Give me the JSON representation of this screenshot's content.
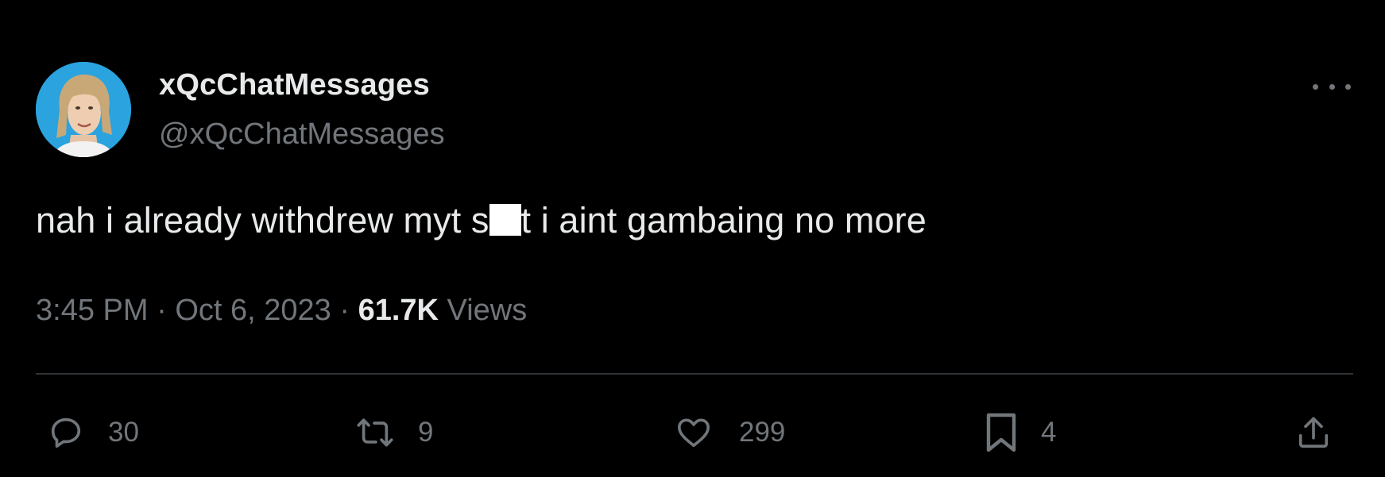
{
  "author": {
    "display_name": "xQcChatMessages",
    "handle": "@xQcChatMessages",
    "avatar": "profile-photo"
  },
  "tweet": {
    "text_before": "nah i already withdrew myt s",
    "text_after": "t i aint gambaing no more"
  },
  "meta": {
    "time": "3:45 PM",
    "separator": "·",
    "date": "Oct 6, 2023",
    "views_count": "61.7K",
    "views_label": "Views"
  },
  "actions": {
    "replies": "30",
    "reposts": "9",
    "likes": "299",
    "bookmarks": "4"
  },
  "icons": {
    "more": "more-icon",
    "reply": "reply-icon",
    "repost": "repost-icon",
    "like": "heart-icon",
    "bookmark": "bookmark-icon",
    "share": "share-icon"
  },
  "colors": {
    "background": "#000000",
    "text_primary": "#e7e9ea",
    "text_secondary": "#71767b",
    "divider": "#2f3336"
  }
}
